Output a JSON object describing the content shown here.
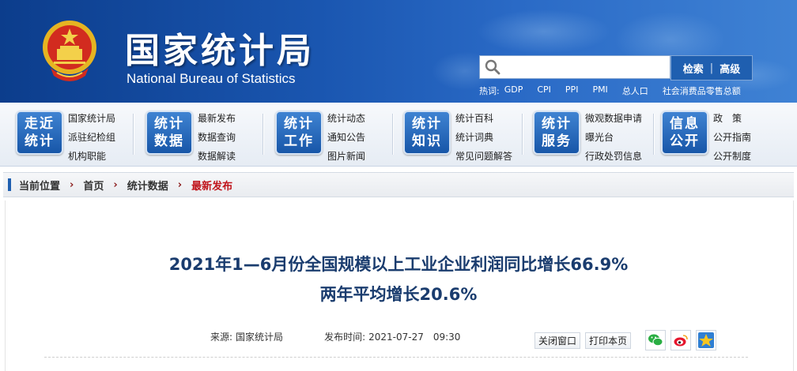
{
  "header": {
    "title": "国家统计局",
    "subtitle": "National Bureau of Statistics",
    "search": {
      "placeholder": "",
      "search_label": "检索",
      "separator": "|",
      "advanced_label": "高级"
    },
    "hot": {
      "label": "热词:",
      "items": [
        "GDP",
        "CPI",
        "PPI",
        "PMI",
        "总人口",
        "社会消费品零售总额"
      ]
    }
  },
  "nav": [
    {
      "tile": [
        "走近",
        "统计"
      ],
      "links": [
        "国家统计局",
        "派驻纪检组",
        "机构职能"
      ]
    },
    {
      "tile": [
        "统计",
        "数据"
      ],
      "links": [
        "最新发布",
        "数据查询",
        "数据解读"
      ]
    },
    {
      "tile": [
        "统计",
        "工作"
      ],
      "links": [
        "统计动态",
        "通知公告",
        "图片新闻"
      ]
    },
    {
      "tile": [
        "统计",
        "知识"
      ],
      "links": [
        "统计百科",
        "统计词典",
        "常见问题解答"
      ]
    },
    {
      "tile": [
        "统计",
        "服务"
      ],
      "links": [
        "微观数据申请",
        "曝光台",
        "行政处罚信息"
      ]
    },
    {
      "tile": [
        "信息",
        "公开"
      ],
      "links": [
        "政　策",
        "公开指南",
        "公开制度"
      ]
    }
  ],
  "breadcrumb": {
    "label": "当前位置",
    "items": [
      "首页",
      "统计数据"
    ],
    "current": "最新发布"
  },
  "article": {
    "title_line1": "2021年1—6月份全国规模以上工业企业利润同比增长66.9%",
    "title_line2": "两年平均增长20.6%",
    "source_label": "来源:",
    "source": "国家统计局",
    "date_label": "发布时间:",
    "date": "2021-07-27　09:30",
    "close_label": "关闭窗口",
    "print_label": "打印本页"
  },
  "colors": {
    "header_blue": "#1a56b0",
    "title_blue": "#1a3c6e",
    "breadcrumb_red": "#c0151c"
  }
}
